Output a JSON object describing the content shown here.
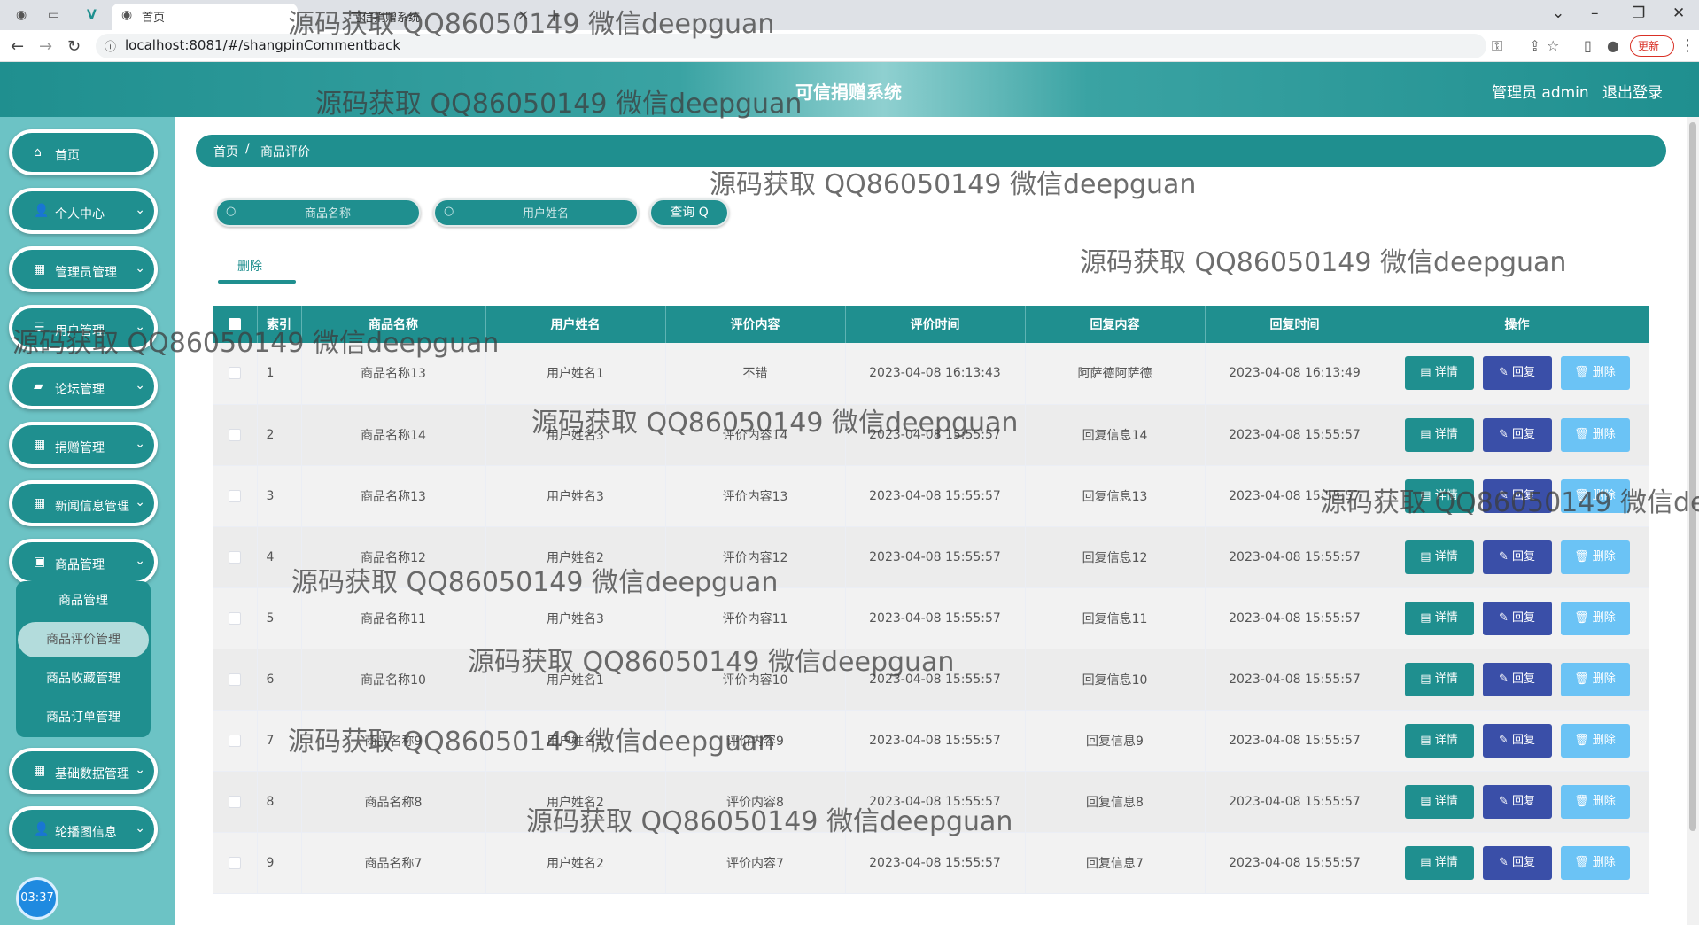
{
  "browser": {
    "tab_active": "首页",
    "tab_second": "可信捐赠系统",
    "url": "localhost:8081/#/shangpinCommentback",
    "update_label": "更新"
  },
  "header": {
    "title": "可信捐赠系统",
    "admin": "管理员 admin",
    "logout": "退出登录"
  },
  "sidebar": {
    "items": [
      {
        "label": "首页",
        "icon": "home-icon"
      },
      {
        "label": "个人中心",
        "icon": "user-icon"
      },
      {
        "label": "管理员管理",
        "icon": "grid-icon"
      },
      {
        "label": "用户管理",
        "icon": "list-icon"
      },
      {
        "label": "论坛管理",
        "icon": "chat-icon"
      },
      {
        "label": "捐赠管理",
        "icon": "grid-icon"
      },
      {
        "label": "新闻信息管理",
        "icon": "grid-icon"
      },
      {
        "label": "商品管理",
        "icon": "bag-icon"
      },
      {
        "label": "基础数据管理",
        "icon": "grid-icon"
      },
      {
        "label": "轮播图信息",
        "icon": "user-icon"
      }
    ],
    "submenu": [
      "商品管理",
      "商品评价管理",
      "商品收藏管理",
      "商品订单管理"
    ],
    "clock": "03:37"
  },
  "breadcrumb": {
    "home": "首页",
    "current": "商品评价"
  },
  "search": {
    "product_placeholder": "商品名称",
    "user_placeholder": "用户姓名",
    "query_label": "查询 Q"
  },
  "toolbar": {
    "delete_label": "删除"
  },
  "table": {
    "headers": [
      "索引",
      "商品名称",
      "用户姓名",
      "评价内容",
      "评价时间",
      "回复内容",
      "回复时间",
      "操作"
    ],
    "rows": [
      {
        "index": "1",
        "product": "商品名称13",
        "user": "用户姓名1",
        "content": "不错",
        "time": "2023-04-08 16:13:43",
        "reply": "阿萨德阿萨德",
        "reply_time": "2023-04-08 16:13:49"
      },
      {
        "index": "2",
        "product": "商品名称14",
        "user": "用户姓名3",
        "content": "评价内容14",
        "time": "2023-04-08 15:55:57",
        "reply": "回复信息14",
        "reply_time": "2023-04-08 15:55:57"
      },
      {
        "index": "3",
        "product": "商品名称13",
        "user": "用户姓名3",
        "content": "评价内容13",
        "time": "2023-04-08 15:55:57",
        "reply": "回复信息13",
        "reply_time": "2023-04-08 15:55:57"
      },
      {
        "index": "4",
        "product": "商品名称12",
        "user": "用户姓名2",
        "content": "评价内容12",
        "time": "2023-04-08 15:55:57",
        "reply": "回复信息12",
        "reply_time": "2023-04-08 15:55:57"
      },
      {
        "index": "5",
        "product": "商品名称11",
        "user": "用户姓名3",
        "content": "评价内容11",
        "time": "2023-04-08 15:55:57",
        "reply": "回复信息11",
        "reply_time": "2023-04-08 15:55:57"
      },
      {
        "index": "6",
        "product": "商品名称10",
        "user": "用户姓名1",
        "content": "评价内容10",
        "time": "2023-04-08 15:55:57",
        "reply": "回复信息10",
        "reply_time": "2023-04-08 15:55:57"
      },
      {
        "index": "7",
        "product": "商品名称9",
        "user": "用户姓名1",
        "content": "评价内容9",
        "time": "2023-04-08 15:55:57",
        "reply": "回复信息9",
        "reply_time": "2023-04-08 15:55:57"
      },
      {
        "index": "8",
        "product": "商品名称8",
        "user": "用户姓名2",
        "content": "评价内容8",
        "time": "2023-04-08 15:55:57",
        "reply": "回复信息8",
        "reply_time": "2023-04-08 15:55:57"
      },
      {
        "index": "9",
        "product": "商品名称7",
        "user": "用户姓名2",
        "content": "评价内容7",
        "time": "2023-04-08 15:55:57",
        "reply": "回复信息7",
        "reply_time": "2023-04-08 15:55:57"
      }
    ],
    "actions": {
      "detail": "▤ 详情",
      "reply": "✎ 回复",
      "delete": "🗑 删除"
    }
  },
  "watermark": "源码获取 QQ86050149 微信deepguan",
  "colors": {
    "primary": "#1f8f8f",
    "sidebar_bg": "#6cc3c5",
    "reply": "#3a4fa8",
    "delete": "#6bc3f5"
  }
}
